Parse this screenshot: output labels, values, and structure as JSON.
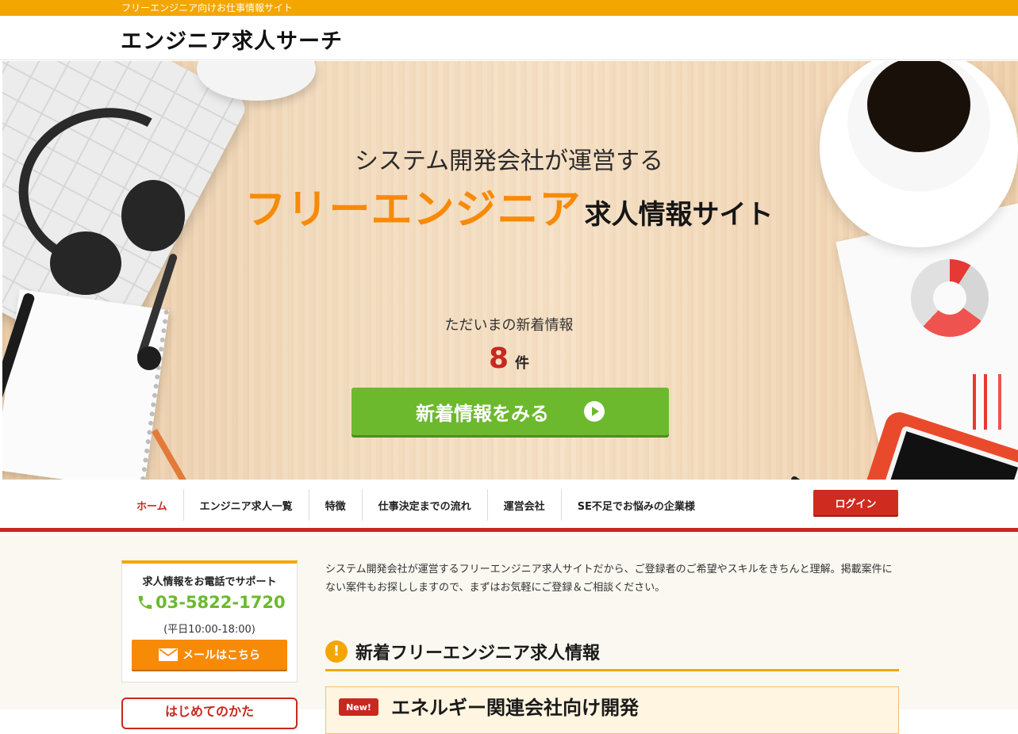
{
  "top_strip": {
    "tagline": "フリーエンジニア向けお仕事情報サイト"
  },
  "header": {
    "logo": "エンジニア求人サーチ"
  },
  "hero": {
    "subtitle": "システム開発会社が運営する",
    "title_accent": "フリーエンジニア",
    "title_rest": "求人情報サイト",
    "news_label": "ただいまの新着情報",
    "news_count": "8",
    "news_unit": "件",
    "cta_label": "新着情報をみる"
  },
  "nav": {
    "items": [
      {
        "label": "ホーム",
        "active": true
      },
      {
        "label": "エンジニア求人一覧"
      },
      {
        "label": "特徴"
      },
      {
        "label": "仕事決定までの流れ"
      },
      {
        "label": "運営会社"
      },
      {
        "label": "SE不足でお悩みの企業様"
      }
    ],
    "login_label": "ログイン"
  },
  "sidebar": {
    "support_title": "求人情報をお電話でサポート",
    "phone": "03-5822-1720",
    "hours": "(平日10:00-18:00)",
    "mail_label": "メールはこちら",
    "beginner_label": "はじめてのかた"
  },
  "main": {
    "intro": "システム開発会社が運営するフリーエンジニア求人サイトだから、ご登録者のご希望やスキルをきちんと理解。掲載案件にない案件もお探ししますので、まずはお気軽にご登録＆ご相談ください。",
    "section_heading": "新着フリーエンジニア求人情報",
    "job_badge": "New!",
    "job_title": "エネルギー関連会社向け開発"
  },
  "colors": {
    "top_strip": "#f4a600",
    "accent_orange": "#f78a06",
    "brand_red": "#c8281f",
    "cta_green": "#6cb92e"
  },
  "icons": [
    "play-circle-icon",
    "phone-icon",
    "mail-icon",
    "alert-icon"
  ]
}
